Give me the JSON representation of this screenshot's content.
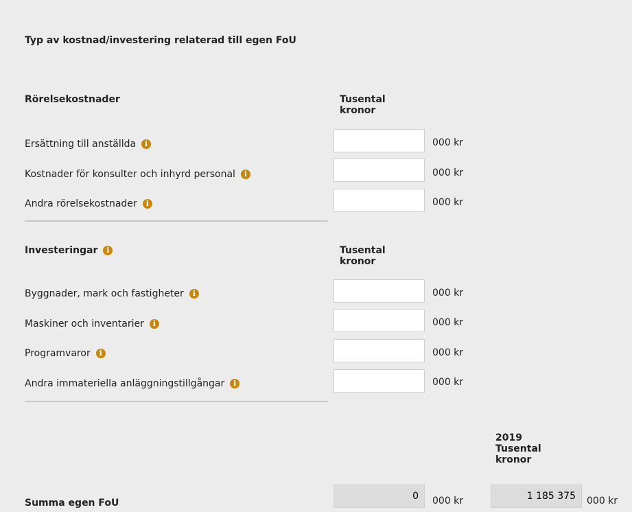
{
  "form": {
    "title": "Typ av kostnad/investering relaterad till egen FoU",
    "operating": {
      "heading": "Rörelsekostnader",
      "column_header": "Tusental kronor",
      "rows": [
        {
          "label": "Ersättning till anställda",
          "value": "",
          "unit": "000 kr"
        },
        {
          "label": "Kostnader för konsulter och inhyrd personal",
          "value": "",
          "unit": "000 kr"
        },
        {
          "label": "Andra rörelsekostnader",
          "value": "",
          "unit": "000 kr"
        }
      ]
    },
    "investments": {
      "heading": "Investeringar",
      "column_header": "Tusental kronor",
      "rows": [
        {
          "label": "Byggnader, mark och fastigheter",
          "value": "",
          "unit": "000 kr"
        },
        {
          "label": "Maskiner och inventarier",
          "value": "",
          "unit": "000 kr"
        },
        {
          "label": "Programvaror",
          "value": "",
          "unit": "000 kr"
        },
        {
          "label": "Andra immateriella anläggningstillgångar",
          "value": "",
          "unit": "000 kr"
        }
      ]
    },
    "summary": {
      "prev_year_header_year": "2019",
      "prev_year_header_unit": "Tusental kronor",
      "label": "Summa egen FoU",
      "current_value": "0",
      "current_unit": "000 kr",
      "prev_value": "1 185 375",
      "prev_unit": "000 kr"
    },
    "info_icon_glyph": "i",
    "colors": {
      "background": "#ececec",
      "info_icon": "#c8860b",
      "readonly_field": "#dcdcdc"
    }
  }
}
